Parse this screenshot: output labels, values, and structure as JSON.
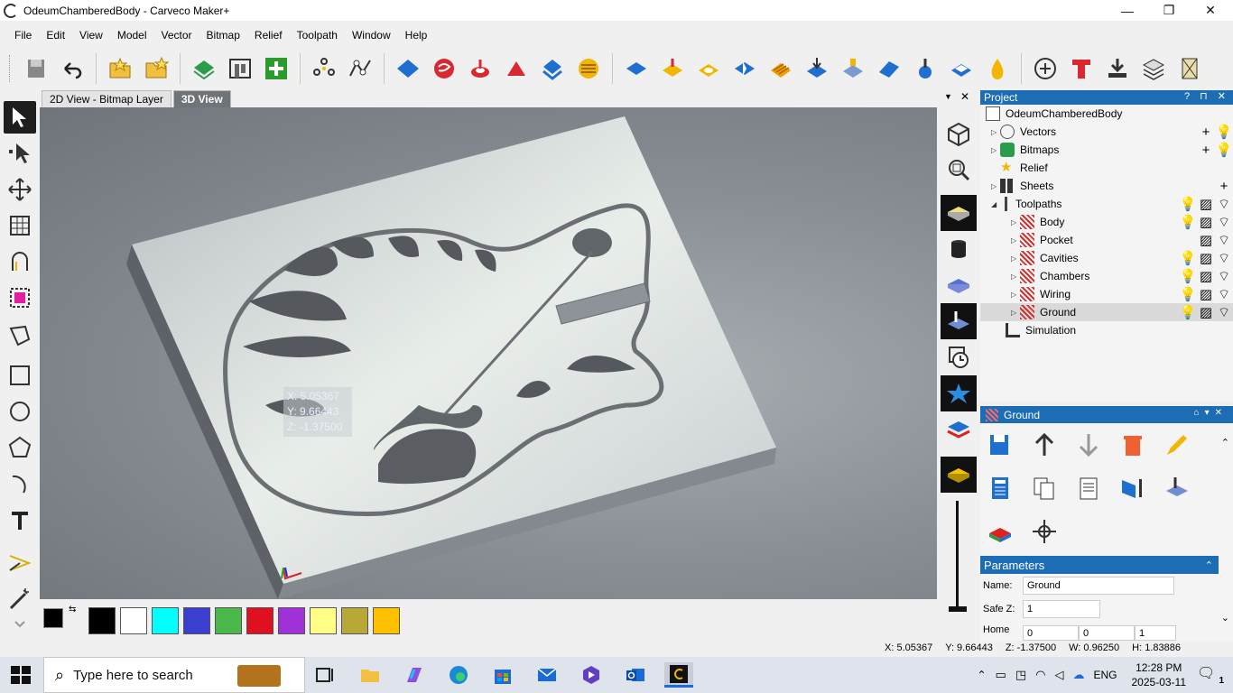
{
  "window": {
    "title": "OdeumChamberedBody - Carveco Maker+",
    "minimize": "—",
    "restore": "❐",
    "close": "✕"
  },
  "menu": [
    "File",
    "Edit",
    "View",
    "Model",
    "Vector",
    "Bitmap",
    "Relief",
    "Toolpath",
    "Window",
    "Help"
  ],
  "tabs": [
    {
      "label": "2D View - Bitmap Layer",
      "active": false
    },
    {
      "label": "3D View",
      "active": true
    }
  ],
  "viewport": {
    "tooltip": {
      "x": "X: 5.05367",
      "y": "Y: 9.66443",
      "z": "Z: -1.37500"
    }
  },
  "palette": {
    "colors": [
      "#000000",
      "#ffffff",
      "#00ffff",
      "#3a3fd0",
      "#4cb84c",
      "#e01020",
      "#a030d8",
      "#ffff88",
      "#b8a838",
      "#ffc000"
    ]
  },
  "project": {
    "header": "Project",
    "header_controls": "? ⊓ ✕",
    "root": "OdeumChamberedBody",
    "items": [
      {
        "label": "Vectors"
      },
      {
        "label": "Bitmaps"
      },
      {
        "label": "Relief"
      },
      {
        "label": "Sheets"
      },
      {
        "label": "Toolpaths"
      }
    ],
    "toolpaths": [
      {
        "label": "Body"
      },
      {
        "label": "Pocket"
      },
      {
        "label": "Cavities"
      },
      {
        "label": "Chambers"
      },
      {
        "label": "Wiring"
      },
      {
        "label": "Ground"
      }
    ],
    "simulation": "Simulation"
  },
  "ground_panel": {
    "title": "Ground",
    "parameters_title": "Parameters",
    "name_label": "Name:",
    "name_value": "Ground",
    "safez_label": "Safe Z:",
    "safez_value": "1",
    "home_label": "Home",
    "home_values": [
      "0",
      "0",
      "1"
    ]
  },
  "status": {
    "x": "X: 5.05367",
    "y": "Y: 9.66443",
    "z": "Z: -1.37500",
    "w": "W: 0.96250",
    "h": "H: 1.83886"
  },
  "taskbar": {
    "search_placeholder": "Type here to search",
    "language": "ENG",
    "time": "12:28 PM",
    "date": "2025-03-11",
    "notifications": "1"
  }
}
